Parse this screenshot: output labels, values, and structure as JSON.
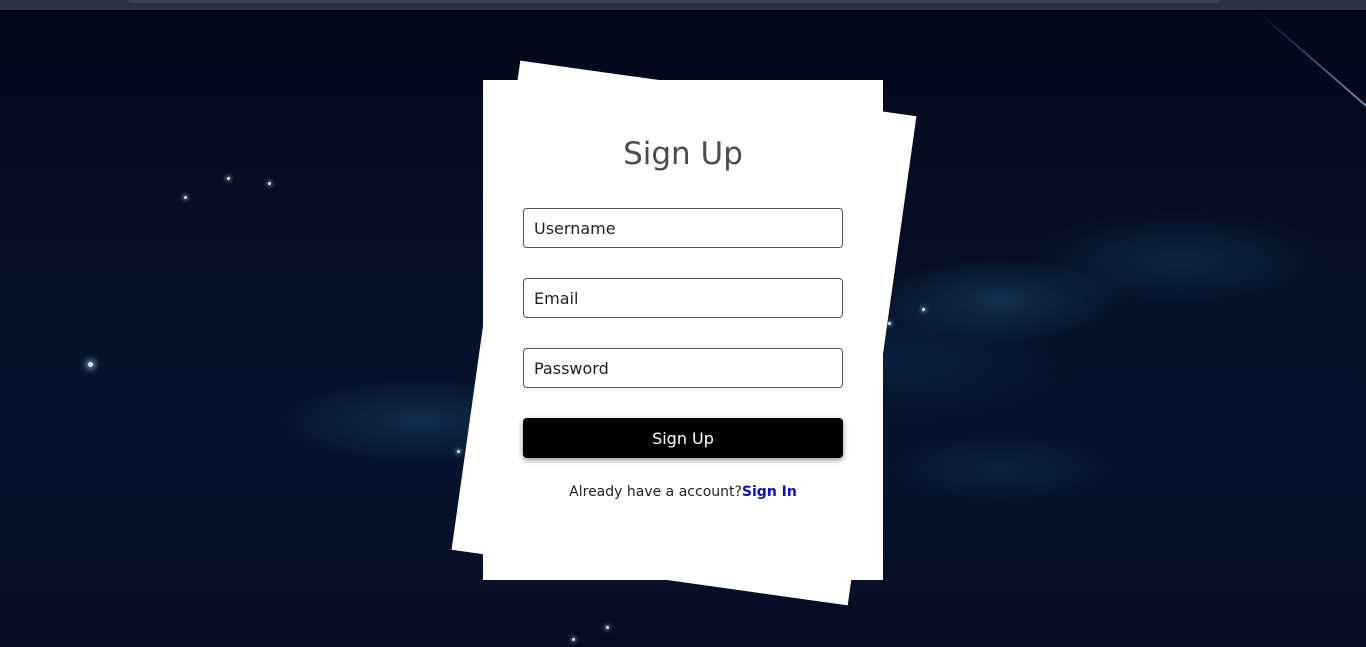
{
  "form": {
    "title": "Sign Up",
    "username_placeholder": "Username",
    "email_placeholder": "Email",
    "password_placeholder": "Password",
    "submit_label": "Sign Up",
    "footer_prompt": "Already have a account?",
    "footer_link": "Sign In"
  },
  "colors": {
    "background": "#061028",
    "card": "#ffffff",
    "button": "#000000",
    "link": "#0a12c8"
  }
}
